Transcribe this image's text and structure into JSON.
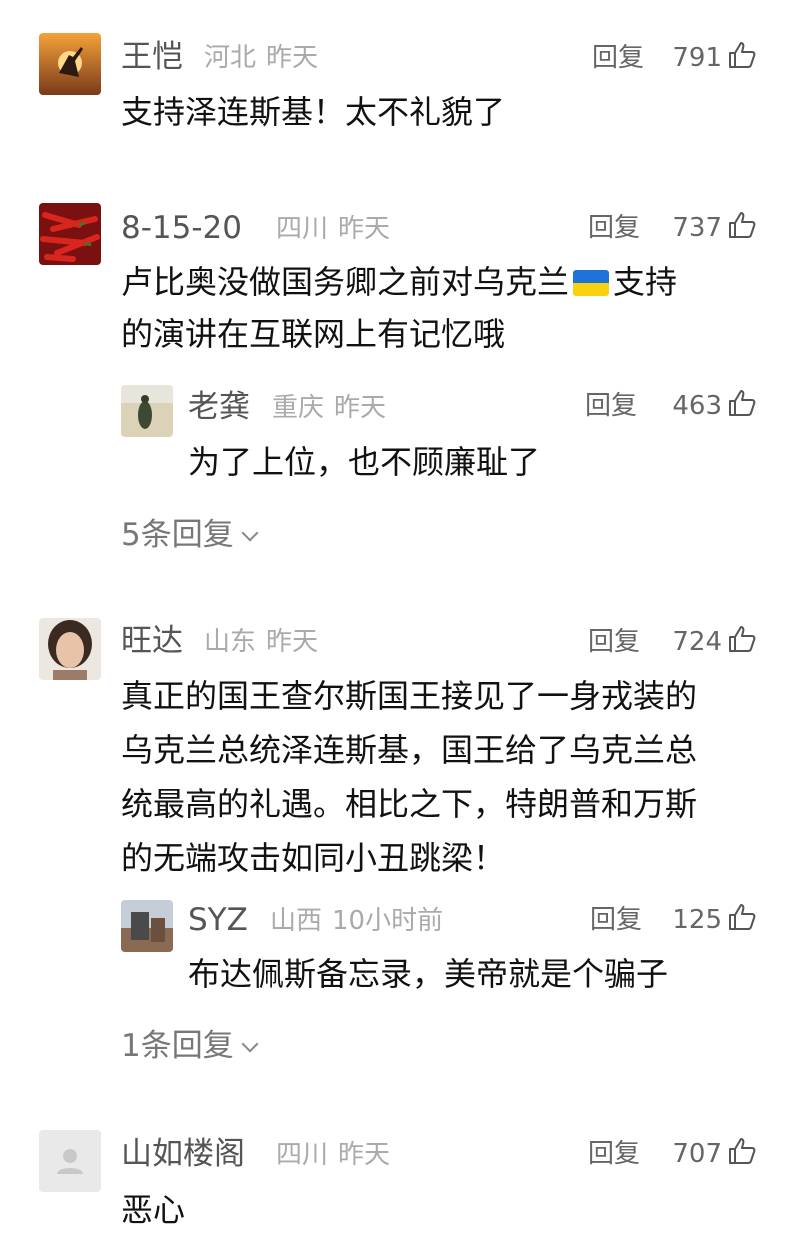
{
  "actions": {
    "reply_label": "回复"
  },
  "comments": [
    {
      "name": "王恺",
      "location": "河北",
      "time": "昨天",
      "likes": "791",
      "lines": [
        "支持泽连斯基！太不礼貌了"
      ]
    },
    {
      "name": "8-15-20",
      "location": "四川",
      "time": "昨天",
      "likes": "737",
      "line1_before_flag": "卢比奥没做国务卿之前对乌克兰",
      "line1_after_flag": "支持",
      "line2": "的演讲在互联网上有记忆哦",
      "flag_colors": [
        "#1e73d8",
        "#f9d20f"
      ],
      "reply": {
        "name": "老龚",
        "location": "重庆",
        "time": "昨天",
        "likes": "463",
        "text": "为了上位，也不顾廉耻了"
      },
      "more_replies": "5条回复"
    },
    {
      "name": "旺达",
      "location": "山东",
      "time": "昨天",
      "likes": "724",
      "lines": [
        "真正的国王查尔斯国王接见了一身戎装的",
        "乌克兰总统泽连斯基，国王给了乌克兰总",
        "统最高的礼遇。相比之下，特朗普和万斯",
        "的无端攻击如同小丑跳梁！"
      ],
      "reply": {
        "name": "SYZ",
        "location": "山西",
        "time": "10小时前",
        "likes": "125",
        "text": "布达佩斯备忘录，美帝就是个骗子"
      },
      "more_replies": "1条回复"
    },
    {
      "name": "山如楼阁",
      "location": "四川",
      "time": "昨天",
      "likes": "707",
      "lines": [
        "恶心"
      ]
    }
  ]
}
